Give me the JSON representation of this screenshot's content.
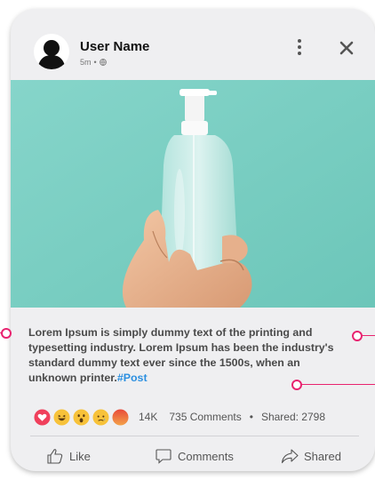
{
  "post": {
    "user_name": "User Name",
    "time": "5m",
    "separator": "•",
    "caption_text": "Lorem Ipsum is simply dummy text of the printing and typesetting industry. Lorem Ipsum has been the industry's standard dummy text ever since the 1500s, when an unknown printer.",
    "hashtag": "#Post"
  },
  "icons": {
    "avatar": "user-silhouette-icon",
    "privacy": "globe-icon",
    "more": "vertical-dots-icon",
    "close": "close-icon",
    "like": "thumbs-up-icon",
    "comment": "speech-bubble-icon",
    "share": "share-arrow-icon"
  },
  "reactions": {
    "icons": [
      "love-icon",
      "haha-icon",
      "wow-icon",
      "sad-icon",
      "angry-icon"
    ],
    "count": "14K",
    "comments": "735 Comments",
    "dot": "•",
    "shared": "Shared: 2798"
  },
  "actions": {
    "like_label": "Like",
    "comments_label": "Comments",
    "shared_label": "Shared"
  },
  "colors": {
    "accent_connector": "#e8236f",
    "hashtag": "#2b8fe0",
    "photo_background": "#7dcfc3",
    "card_background": "#efeff1"
  }
}
